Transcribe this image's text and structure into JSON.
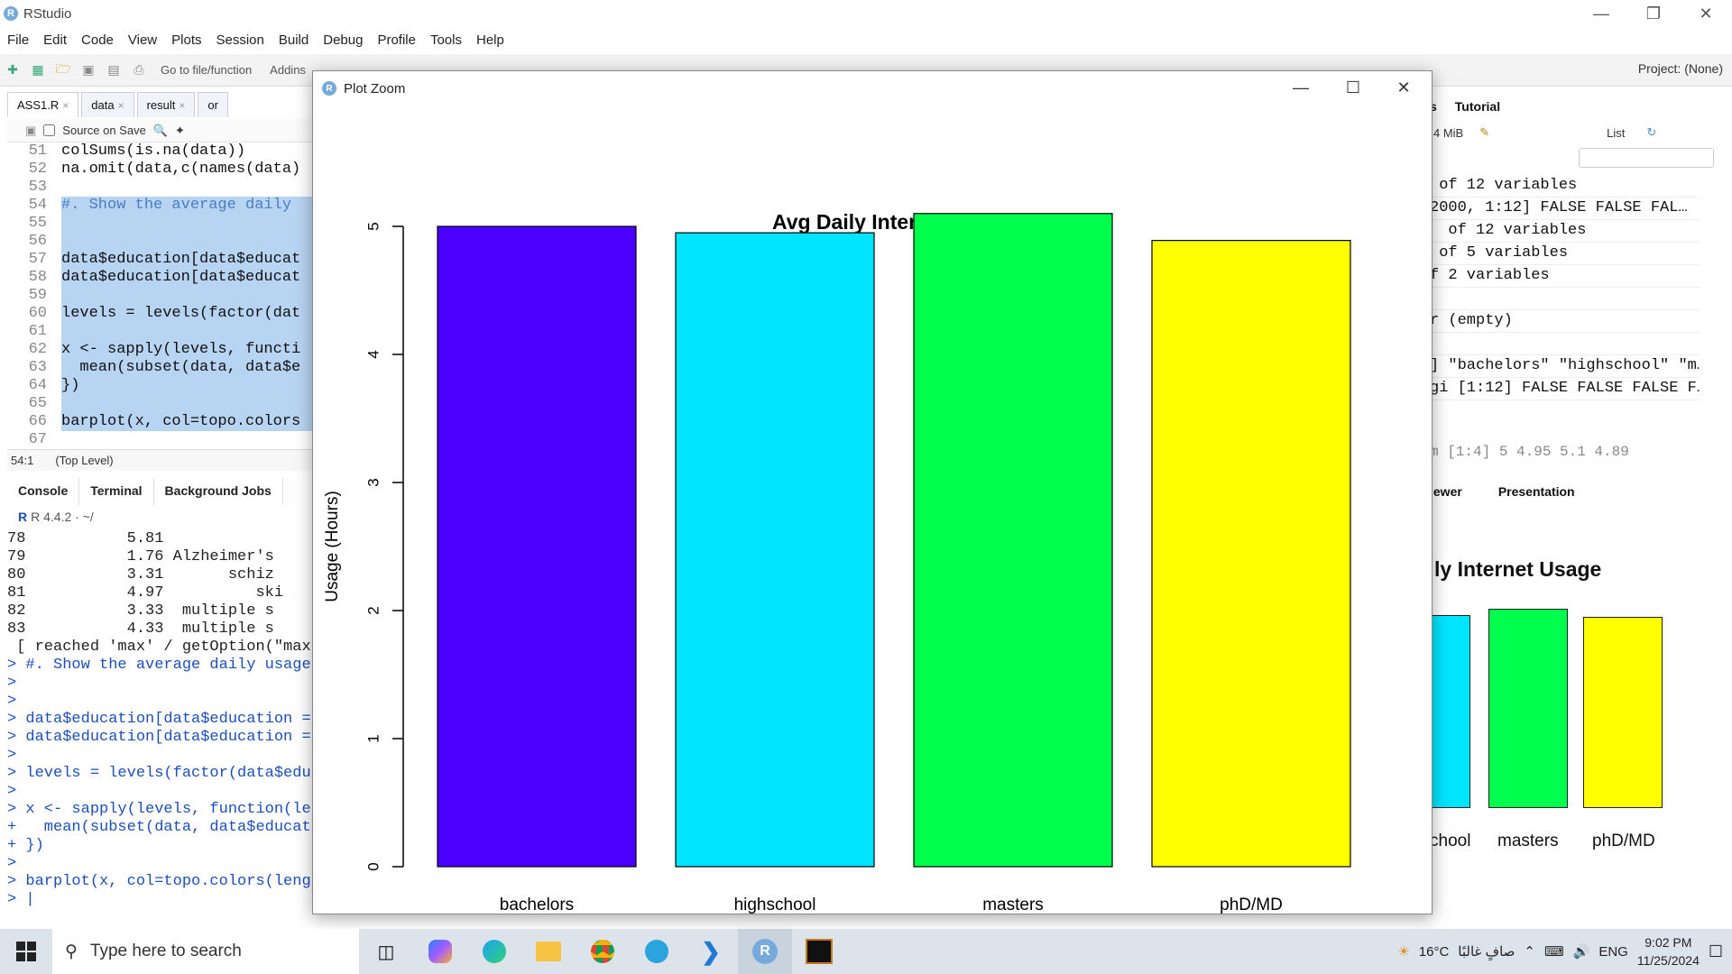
{
  "window": {
    "app_title": "RStudio"
  },
  "menu": [
    "File",
    "Edit",
    "Code",
    "View",
    "Plots",
    "Session",
    "Build",
    "Debug",
    "Profile",
    "Tools",
    "Help"
  ],
  "toolbar": {
    "goto_placeholder": "Go to file/function",
    "addins": "Addins",
    "project": "Project: (None)"
  },
  "editor": {
    "tabs": [
      {
        "label": "ASS1.R"
      },
      {
        "label": "data"
      },
      {
        "label": "result"
      },
      {
        "label": "or"
      }
    ],
    "source_on_save": "Source on Save",
    "lines": [
      {
        "n": "51",
        "t": "colSums(is.na(data))"
      },
      {
        "n": "52",
        "t": "na.omit(data,c(names(data)"
      },
      {
        "n": "53",
        "t": ""
      },
      {
        "n": "54",
        "t": "#. Show the average daily"
      },
      {
        "n": "55",
        "t": ""
      },
      {
        "n": "56",
        "t": ""
      },
      {
        "n": "57",
        "t": "data$education[data$educat"
      },
      {
        "n": "58",
        "t": "data$education[data$educat"
      },
      {
        "n": "59",
        "t": ""
      },
      {
        "n": "60",
        "t": "levels = levels(factor(dat"
      },
      {
        "n": "61",
        "t": ""
      },
      {
        "n": "62",
        "t": "x <- sapply(levels, functi"
      },
      {
        "n": "63",
        "t": "  mean(subset(data, data$e"
      },
      {
        "n": "64",
        "t": "})"
      },
      {
        "n": "65",
        "t": ""
      },
      {
        "n": "66",
        "t": "barplot(x, col=topo.colors"
      },
      {
        "n": "67",
        "t": ""
      },
      {
        "n": "68",
        "t": ""
      }
    ],
    "cursor_pos": "54:1",
    "scope": "(Top Level)"
  },
  "console": {
    "tabs": [
      "Console",
      "Terminal",
      "Background Jobs"
    ],
    "r_version": "R 4.4.2 · ~/",
    "lines": [
      {
        "t": "78           5.81",
        "p": false
      },
      {
        "t": "79           1.76 Alzheimer's",
        "p": false
      },
      {
        "t": "80           3.31       schiz",
        "p": false
      },
      {
        "t": "81           4.97          ski",
        "p": false
      },
      {
        "t": "82           3.33  multiple s",
        "p": false
      },
      {
        "t": "83           4.33  multiple s",
        "p": false
      },
      {
        "t": " [ reached 'max' / getOption(\"max",
        "p": false
      },
      {
        "t": "> #. Show the average daily usage",
        "p": true
      },
      {
        "t": ">",
        "p": true
      },
      {
        "t": ">",
        "p": true
      },
      {
        "t": "> data$education[data$education =",
        "p": true
      },
      {
        "t": "> data$education[data$education =",
        "p": true
      },
      {
        "t": ">",
        "p": true
      },
      {
        "t": "> levels = levels(factor(data$edu",
        "p": true
      },
      {
        "t": ">",
        "p": true
      },
      {
        "t": "> x <- sapply(levels, function(le",
        "p": true
      },
      {
        "t": "+   mean(subset(data, data$educat",
        "p": true
      },
      {
        "t": "+ })",
        "p": true
      },
      {
        "t": ">",
        "p": true
      },
      {
        "t": "> barplot(x, col=topo.colors(leng",
        "p": true
      },
      {
        "t": "> |",
        "p": true
      }
    ]
  },
  "environment": {
    "tabs": [
      "s",
      "Tutorial"
    ],
    "memory": "4 MiB",
    "view_mode": "List",
    "rows": [
      " of 12 variables",
      "2000, 1:12] FALSE FALSE FAL…",
      "  of 12 variables",
      " of 5 variables",
      "f 2 variables",
      "",
      "r (empty)",
      "",
      "] \"bachelors\" \"highschool\" \"m…",
      "gi [1:12] FALSE FALSE FALSE F…"
    ],
    "last_row": "m [1:4] 5 4.95 5.1 4.89"
  },
  "viewer": {
    "tabs": [
      "iewer",
      "Presentation"
    ],
    "title": "ly Internet Usage",
    "labels": [
      "chool",
      "masters",
      "phD/MD"
    ]
  },
  "plot_zoom": {
    "title": "Plot Zoom"
  },
  "chart_data": {
    "type": "bar",
    "title": "Avg Daily Internet Usage",
    "xlabel": "",
    "ylabel": "Usage (Hours)",
    "categories": [
      "bachelors",
      "highschool",
      "masters",
      "phD/MD"
    ],
    "values": [
      5,
      4.95,
      5.1,
      4.89
    ],
    "colors": [
      "#4C00FF",
      "#00E5FF",
      "#00FF4D",
      "#FFFF00"
    ],
    "yticks": [
      0,
      1,
      2,
      3,
      4,
      5
    ],
    "ylim": [
      0,
      5.1
    ]
  },
  "taskbar": {
    "search_placeholder": "Type here to search",
    "weather": "16°C",
    "weather_text": "صافٍ غالبًا",
    "lang": "ENG",
    "time": "9:02 PM",
    "date": "11/25/2024"
  }
}
